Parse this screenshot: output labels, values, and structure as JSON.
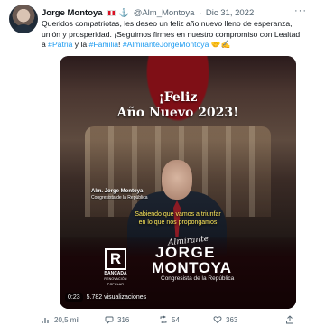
{
  "tweet": {
    "author_name": "Jorge Montoya",
    "handle": "@Alm_Montoya",
    "separator": "·",
    "date": "Dic 31, 2022",
    "anchor_glyph": "⚓",
    "text_line1": "Queridos compatriotas, les deseo un feliz año nuevo lleno de esperanza,",
    "text_line2": "unión y prosperidad. ¡Seguimos firmes en nuestro compromiso con Lealtad",
    "text_line3_prefix": "a",
    "hashtag_patria": "#Patria",
    "text_and": "y la",
    "hashtag_familia": "#Familia",
    "text_exclaim": "!",
    "hashtag_almirante": "#AlmiranteJorgeMontoya",
    "emoji_tail": "🤝✍"
  },
  "media": {
    "greeting_line1": "¡Feliz",
    "greeting_line2": "Año Nuevo 2023!",
    "caption_name": "Alm. Jorge Montoya",
    "caption_role": "Congresista de la República",
    "subtitle_line1": "Sabiendo que vamos a triunfar",
    "subtitle_line2": "en lo que nos propongamos",
    "logo_letter": "R",
    "logo_label": "BANCADA",
    "logo_sub": "RENOVACIÓN POPULAR",
    "signature": "Almirante",
    "brand_first": "JORGE",
    "brand_last": "MONTOYA",
    "brand_role": "Congresista de la República",
    "time": "0:23",
    "views": "5.782 visualizaciones"
  },
  "actions": {
    "views_count": "20,5 mil",
    "reply_count": "316",
    "retweet_count": "54",
    "like_count": "363"
  },
  "icons": {
    "more": "more-icon",
    "views": "views-icon",
    "reply": "reply-icon",
    "retweet": "retweet-icon",
    "like": "like-icon",
    "share": "share-icon"
  },
  "colors": {
    "link": "#1d9bf0",
    "text": "#0f1419",
    "meta": "#536471",
    "video_bg": "#0c0c0d",
    "flag_red": "#d91023"
  }
}
